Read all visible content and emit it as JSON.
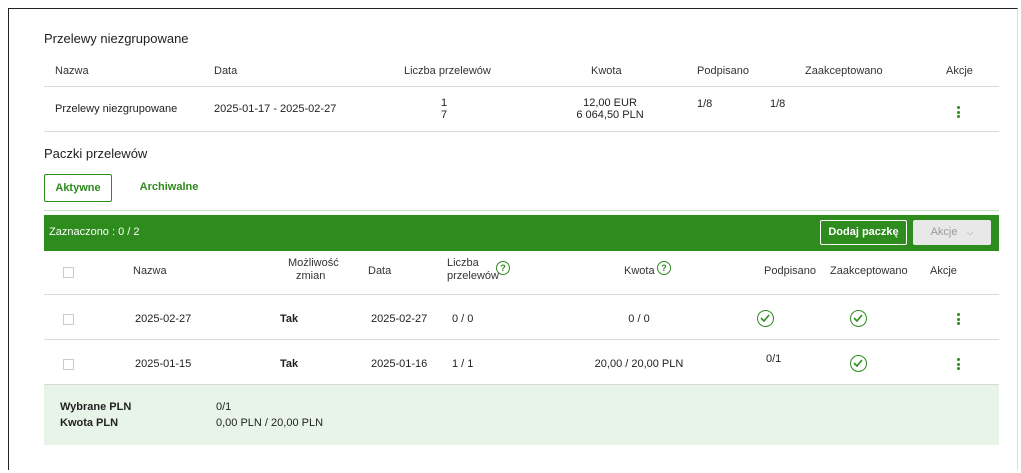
{
  "ungrouped": {
    "title": "Przelewy niezgrupowane",
    "headers": {
      "nazwa": "Nazwa",
      "data": "Data",
      "liczba": "Liczba przelewów",
      "kwota": "Kwota",
      "podpisano": "Podpisano",
      "zaakceptowano": "Zaakceptowano",
      "akcje": "Akcje"
    },
    "row": {
      "nazwa": "Przelewy niezgrupowane",
      "data": "2025-01-17 - 2025-02-27",
      "liczba_line1": "1",
      "liczba_line2": "7",
      "kwota_line1": "12,00 EUR",
      "kwota_line2": "6 064,50 PLN",
      "podpisano": "1/8",
      "zaakceptowano": "1/8"
    }
  },
  "packages": {
    "title": "Paczki przelewów",
    "tabs": [
      "Aktywne",
      "Archiwalne"
    ],
    "toolbar": {
      "selected": "Zaznaczono : 0 / 2",
      "add_label": "Dodaj paczkę",
      "actions_label": "Akcje"
    },
    "headers": {
      "nazwa": "Nazwa",
      "mozliwosc_line1": "Możliwość",
      "mozliwosc_line2": "zmian",
      "data": "Data",
      "liczba_line1": "Liczba",
      "liczba_line2": "przelewów",
      "kwota": "Kwota",
      "podpisano": "Podpisano",
      "zaakceptowano": "Zaakceptowano",
      "akcje": "Akcje"
    },
    "rows": [
      {
        "nazwa": "2025-02-27",
        "mozliwosc": "Tak",
        "data": "2025-02-27",
        "liczba": "0 / 0",
        "kwota": "0 / 0",
        "podpisano": "",
        "podpisano_icon": "check-circle-icon",
        "zaakceptowano_icon": "check-circle-icon"
      },
      {
        "nazwa": "2025-01-15",
        "mozliwosc": "Tak",
        "data": "2025-01-16",
        "liczba": "1 / 1",
        "kwota": "20,00 / 20,00 PLN",
        "podpisano": "0/1",
        "podpisano_icon": "",
        "zaakceptowano_icon": "check-circle-icon"
      }
    ],
    "summary": {
      "label1": "Wybrane PLN",
      "value1": "0/1",
      "label2": "Kwota PLN",
      "value2": "0,00 PLN / 20,00 PLN"
    }
  },
  "colors": {
    "accent": "#2e8b1e",
    "summary_bg": "#e9f4e9"
  }
}
